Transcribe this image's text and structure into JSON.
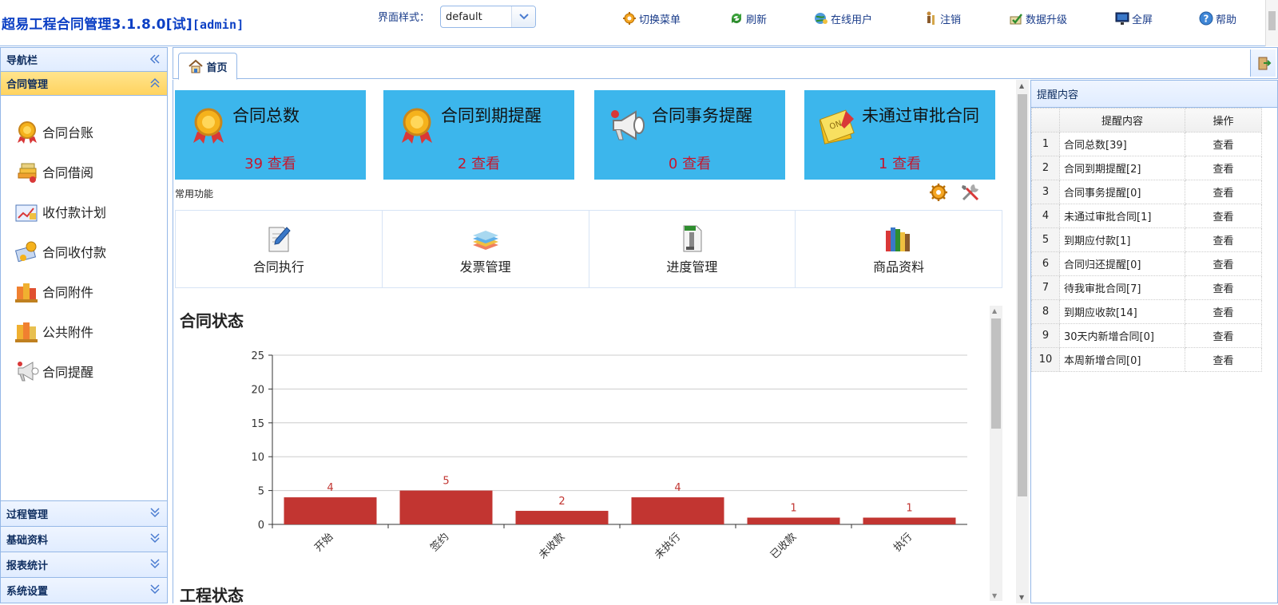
{
  "header": {
    "app_title": "超易工程合同管理3.1.8.0[试]",
    "user": "[admin]",
    "theme_label": "界面样式：",
    "theme_value": "default",
    "toolbar": [
      {
        "label": "切换菜单",
        "icon": "switch-menu-icon"
      },
      {
        "label": "刷新",
        "icon": "refresh-icon"
      },
      {
        "label": "在线用户",
        "icon": "online-users-icon"
      },
      {
        "label": "注销",
        "icon": "logout-icon"
      },
      {
        "label": "数据升级",
        "icon": "data-upgrade-icon"
      },
      {
        "label": "全屏",
        "icon": "fullscreen-icon"
      },
      {
        "label": "帮助",
        "icon": "help-icon"
      }
    ]
  },
  "sidebar": {
    "title": "导航栏",
    "active_group": "合同管理",
    "items": [
      {
        "label": "合同台账",
        "icon": "medal-icon"
      },
      {
        "label": "合同借阅",
        "icon": "books-icon"
      },
      {
        "label": "收付款计划",
        "icon": "chart-plan-icon"
      },
      {
        "label": "合同收付款",
        "icon": "payment-icon"
      },
      {
        "label": "合同附件",
        "icon": "attachment-icon"
      },
      {
        "label": "公共附件",
        "icon": "public-attachment-icon"
      },
      {
        "label": "合同提醒",
        "icon": "megaphone-icon"
      }
    ],
    "groups": [
      "过程管理",
      "基础资料",
      "报表统计",
      "系统设置"
    ]
  },
  "tabs": {
    "home": "首页"
  },
  "cards": [
    {
      "title": "合同总数",
      "count": "39 查看",
      "icon": "medal-icon"
    },
    {
      "title": "合同到期提醒",
      "count": "2 查看",
      "icon": "medal-icon"
    },
    {
      "title": "合同事务提醒",
      "count": "0 查看",
      "icon": "megaphone-icon"
    },
    {
      "title": "未通过审批合同",
      "count": "1 查看",
      "icon": "sticky-note-icon"
    }
  ],
  "quick": {
    "label": "常用功能",
    "items": [
      {
        "label": "合同执行",
        "icon": "document-pen-icon"
      },
      {
        "label": "发票管理",
        "icon": "invoice-stack-icon"
      },
      {
        "label": "进度管理",
        "icon": "progress-file-icon"
      },
      {
        "label": "商品资料",
        "icon": "product-books-icon"
      }
    ]
  },
  "chart_title": "合同状态",
  "second_title": "工程状态",
  "chart_data": {
    "type": "bar",
    "title": "合同状态",
    "categories": [
      "开始",
      "签约",
      "未收款",
      "未执行",
      "已收款",
      "执行"
    ],
    "values": [
      4,
      5,
      2,
      4,
      1,
      1
    ],
    "ylim": [
      0,
      25
    ],
    "yticks": [
      0,
      5,
      10,
      15,
      20,
      25
    ],
    "grid": true,
    "bar_color": "#c23531",
    "label_color": "#c23531"
  },
  "reminder": {
    "title": "提醒内容",
    "headers": [
      "提醒内容",
      "操作"
    ],
    "rows": [
      {
        "num": "1",
        "content": "合同总数[39]",
        "op": "查看"
      },
      {
        "num": "2",
        "content": "合同到期提醒[2]",
        "op": "查看"
      },
      {
        "num": "3",
        "content": "合同事务提醒[0]",
        "op": "查看"
      },
      {
        "num": "4",
        "content": "未通过审批合同[1]",
        "op": "查看"
      },
      {
        "num": "5",
        "content": "到期应付款[1]",
        "op": "查看"
      },
      {
        "num": "6",
        "content": "合同归还提醒[0]",
        "op": "查看"
      },
      {
        "num": "7",
        "content": "待我审批合同[7]",
        "op": "查看"
      },
      {
        "num": "8",
        "content": "到期应收款[14]",
        "op": "查看"
      },
      {
        "num": "9",
        "content": "30天内新增合同[0]",
        "op": "查看"
      },
      {
        "num": "10",
        "content": "本周新增合同[0]",
        "op": "查看"
      }
    ]
  },
  "colors": {
    "card_bg": "#3cb6ec",
    "count_red": "#c7162c",
    "border_blue": "#95b8e7",
    "active_group": "#ffd35f"
  }
}
